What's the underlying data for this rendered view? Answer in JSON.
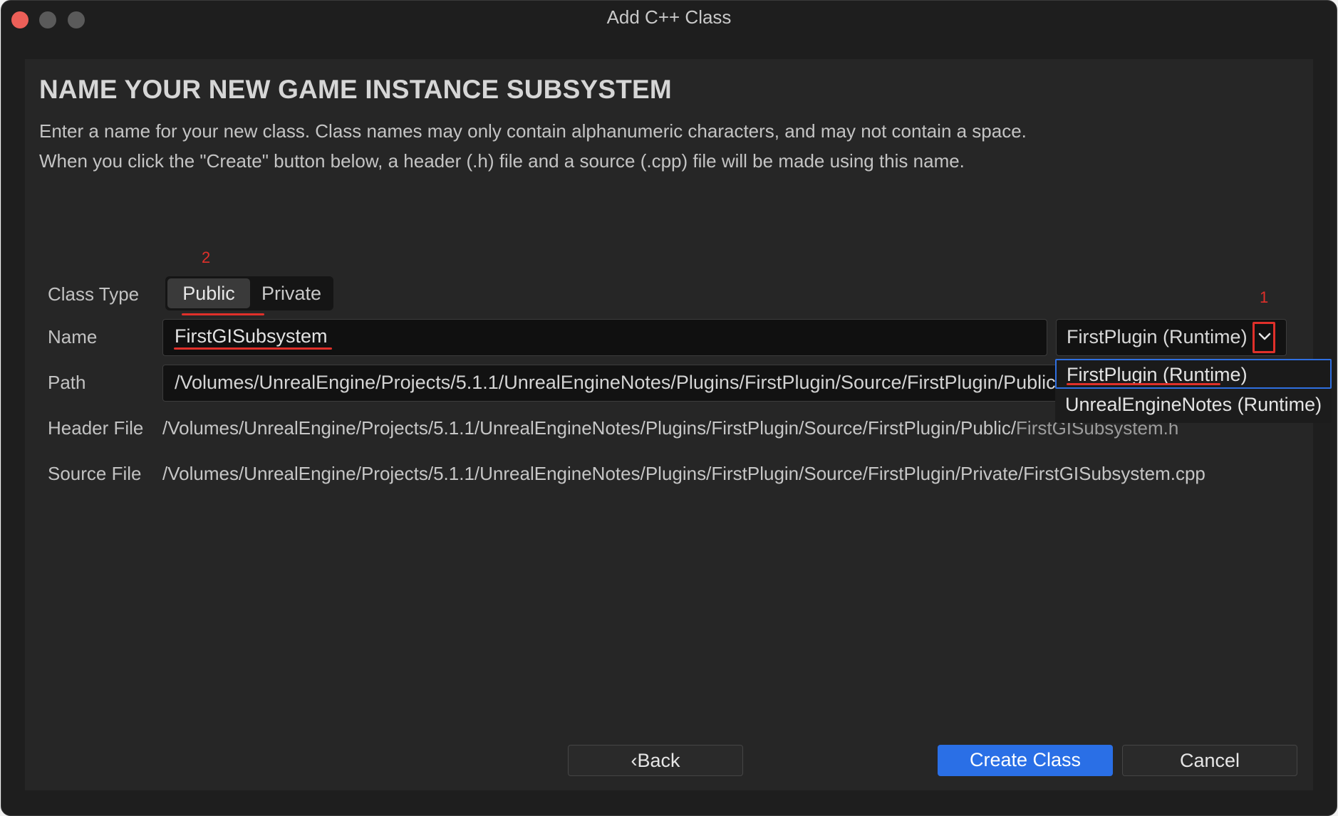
{
  "window": {
    "title": "Add C++ Class"
  },
  "page": {
    "heading": "NAME YOUR NEW GAME INSTANCE SUBSYSTEM",
    "description_line1": "Enter a name for your new class. Class names may only contain alphanumeric characters, and may not contain a space.",
    "description_line2": "When you click the \"Create\" button below, a header (.h) file and a source (.cpp) file will be made using this name."
  },
  "annotations": {
    "marker_2": "2",
    "marker_1": "1",
    "color": "#e0302a"
  },
  "form": {
    "class_type_label": "Class Type",
    "class_type_options": {
      "public": "Public",
      "private": "Private",
      "selected": "Public"
    },
    "name_label": "Name",
    "name_value": "FirstGISubsystem",
    "module_selected": "FirstPlugin (Runtime)",
    "path_label": "Path",
    "path_value": "/Volumes/UnrealEngine/Projects/5.1.1/UnrealEngineNotes/Plugins/FirstPlugin/Source/FirstPlugin/Public/",
    "header_label": "Header File",
    "header_dir": "/Volumes/UnrealEngine/Projects/5.1.1/UnrealEngineNotes/Plugins/FirstPlugin/Source/FirstPlugin/Public/",
    "header_file": "FirstGISubsystem.h",
    "source_label": "Source File",
    "source_path": "/Volumes/UnrealEngine/Projects/5.1.1/UnrealEngineNotes/Plugins/FirstPlugin/Source/FirstPlugin/Private/FirstGISubsystem.cpp"
  },
  "module_dropdown": {
    "options": [
      "FirstPlugin (Runtime)",
      "UnrealEngineNotes (Runtime)"
    ],
    "selected": "FirstPlugin (Runtime)"
  },
  "buttons": {
    "back": "Back",
    "create": "Create Class",
    "cancel": "Cancel"
  },
  "colors": {
    "accent": "#2a6fe6",
    "background": "#262626",
    "annotation": "#e0302a"
  }
}
